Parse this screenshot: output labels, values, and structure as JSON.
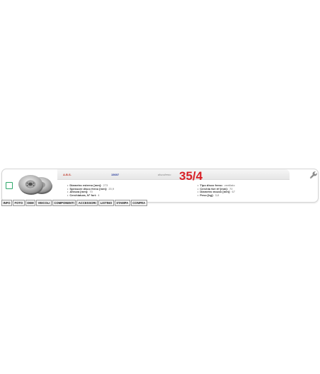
{
  "product": {
    "brand": "A.B.S.",
    "code": "15697",
    "type_label": "discofreno",
    "ref_code": "35/4",
    "specs_left": [
      {
        "label": "Diametro esterno [mm]:",
        "value": "273"
      },
      {
        "label": "Spessore disco freno [mm]:",
        "value": "20,9"
      },
      {
        "label": "Altezza [mm]:",
        "value": "70"
      },
      {
        "label": "Cerchiatura, N° fori:",
        "value": "4"
      }
    ],
    "specs_right": [
      {
        "label": "Tipo disco freno:",
        "value": "ventilato"
      },
      {
        "label": "Cerchia fori rif [mm]:",
        "value": "70"
      },
      {
        "label": "Diametro mozzo [mm]:",
        "value": "67"
      },
      {
        "label": "Peso [kg]:",
        "value": "3,8"
      }
    ]
  },
  "icons": {
    "select": "checkbox-icon",
    "product_image": "brake-disc-icon",
    "tools": "wrench-icon"
  },
  "colors": {
    "brand": "#c0392b",
    "code": "#2b3f9e",
    "ref_code": "#d81f26",
    "checkbox": "#2fa86b"
  },
  "tabs": [
    {
      "label": "INFO"
    },
    {
      "label": "FOTO"
    },
    {
      "label": "OEM"
    },
    {
      "label": "VEICOLI"
    },
    {
      "label": "COMPONENTI"
    },
    {
      "label": "ACCESSORI"
    },
    {
      "label": "LISTINO"
    },
    {
      "label": "STAMPA"
    },
    {
      "label": "CONFRA"
    }
  ]
}
